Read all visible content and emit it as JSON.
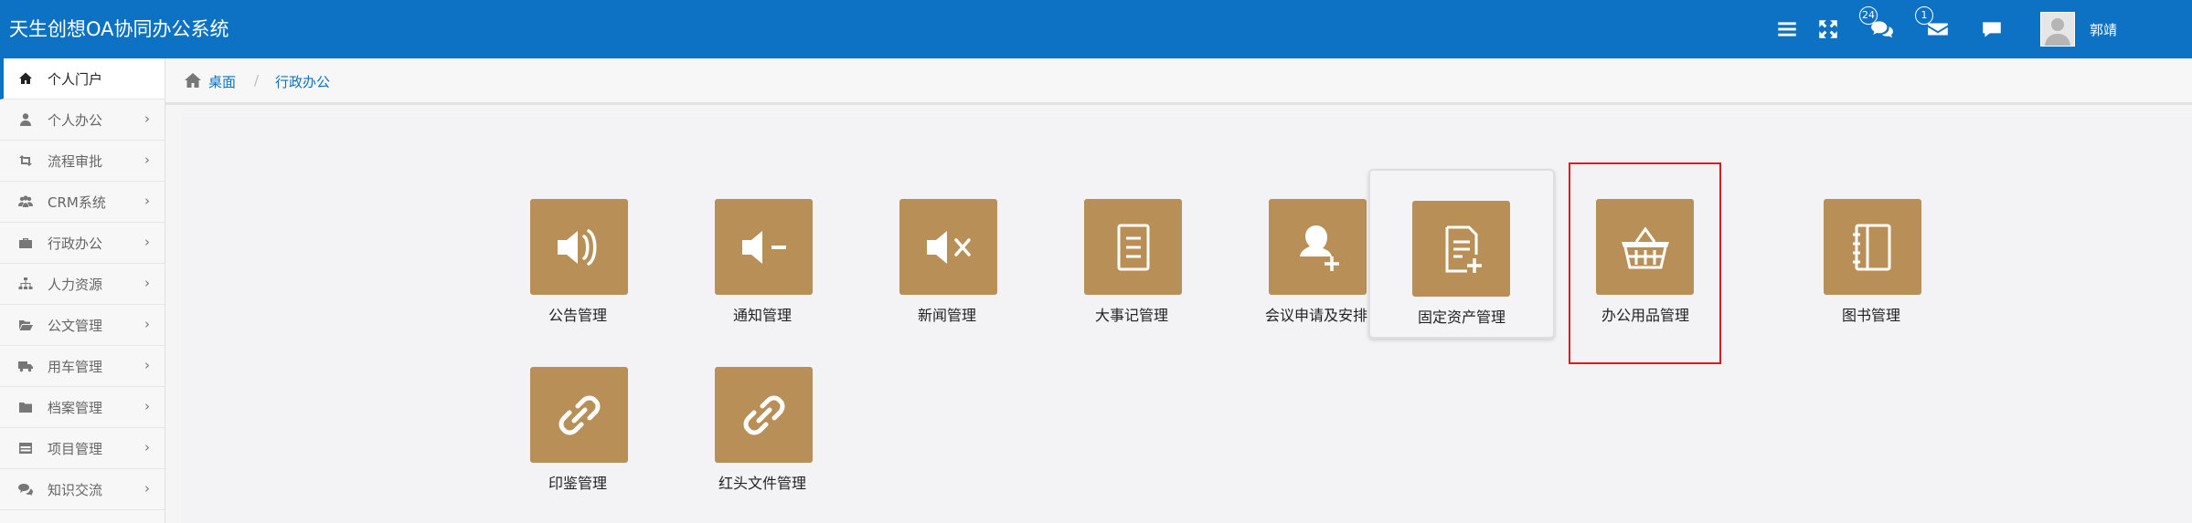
{
  "header": {
    "app_title": "天生创想OA协同办公系统",
    "icons": [
      "menu-icon",
      "fullscreen-icon",
      "chat-icon",
      "mail-icon",
      "comment-icon"
    ],
    "chat_badge": "24",
    "mail_badge": "1",
    "username": "郭靖",
    "colors": {
      "bar": "#0e72c4"
    }
  },
  "sidebar": {
    "items": [
      {
        "label": "个人门户",
        "icon": "home-icon",
        "active": true
      },
      {
        "label": "个人办公",
        "icon": "user-icon"
      },
      {
        "label": "流程审批",
        "icon": "retweet-icon"
      },
      {
        "label": "CRM系统",
        "icon": "group-icon"
      },
      {
        "label": "行政办公",
        "icon": "briefcase-icon"
      },
      {
        "label": "人力资源",
        "icon": "sitemap-icon"
      },
      {
        "label": "公文管理",
        "icon": "folder-open-icon"
      },
      {
        "label": "用车管理",
        "icon": "truck-icon"
      },
      {
        "label": "档案管理",
        "icon": "folder-icon"
      },
      {
        "label": "项目管理",
        "icon": "table-icon"
      },
      {
        "label": "知识交流",
        "icon": "comments-icon"
      }
    ],
    "chevron": "›"
  },
  "breadcrumb": {
    "home": "桌面",
    "separator": "/",
    "current": "行政办公"
  },
  "tiles": [
    {
      "label": "公告管理",
      "icon": "megaphone-icon"
    },
    {
      "label": "通知管理",
      "icon": "volume-down-icon"
    },
    {
      "label": "新闻管理",
      "icon": "volume-off-icon"
    },
    {
      "label": "大事记管理",
      "icon": "document-icon"
    },
    {
      "label": "会议申请及安排",
      "icon": "add-user-icon"
    },
    {
      "label": "固定资产管理",
      "icon": "document-add-icon"
    },
    {
      "label": "办公用品管理",
      "icon": "basket-icon"
    },
    {
      "label": "图书管理",
      "icon": "notebook-icon"
    },
    {
      "label": "印鉴管理",
      "icon": "link-icon"
    },
    {
      "label": "红头文件管理",
      "icon": "link-icon"
    }
  ],
  "colors": {
    "tile": "#b88f57",
    "highlight": "#e01818",
    "link": "#0e72c4"
  }
}
